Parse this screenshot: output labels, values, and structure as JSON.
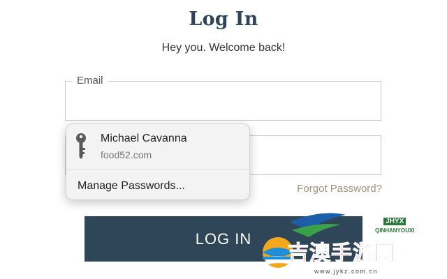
{
  "header": {
    "title": "Log In",
    "subtitle": "Hey you. Welcome back!"
  },
  "form": {
    "email_label": "Email",
    "email_value": "",
    "password_value": "",
    "forgot_label": "Forgot Password?",
    "login_label": "LOG IN"
  },
  "autofill_popup": {
    "credential_name": "Michael Cavanna",
    "credential_site": "food52.com",
    "manage_label": "Manage Passwords...",
    "icon": "key-icon"
  },
  "watermark": {
    "brand_code": "JHYX",
    "brand_name": "QINHANYOUXI",
    "text": "吉澳手游网",
    "url": "www.jykz.com.cn"
  },
  "colors": {
    "primary": "#2f4558",
    "title": "#2e4458",
    "link": "#a3907b"
  }
}
